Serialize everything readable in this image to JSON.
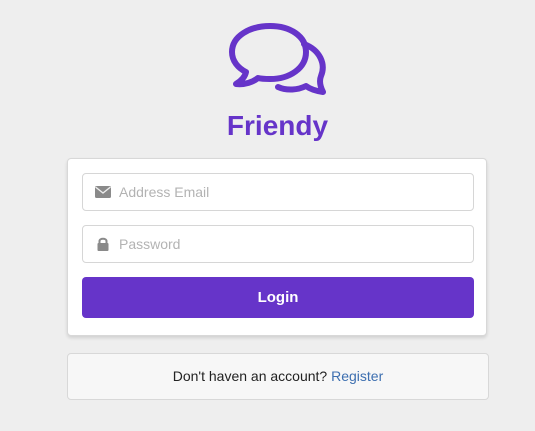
{
  "brand": {
    "name": "Friendy",
    "logo_icon": "chat-bubbles-icon",
    "color": "#6634c9"
  },
  "login_form": {
    "email_placeholder": "Address Email",
    "email_value": "",
    "email_icon": "envelope-icon",
    "password_placeholder": "Password",
    "password_value": "",
    "password_icon": "lock-icon",
    "submit_label": "Login",
    "submit_color": "#6634c9"
  },
  "register": {
    "prompt": "Don't haven an account?",
    "link_label": "Register",
    "link_color": "#3d6fb0"
  }
}
